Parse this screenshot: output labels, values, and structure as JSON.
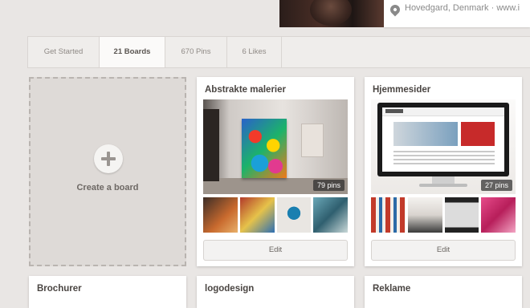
{
  "header": {
    "location": "Hovedgard, Denmark · www.i"
  },
  "tabs": [
    {
      "label": "Get Started"
    },
    {
      "label": "21 Boards"
    },
    {
      "label": "670 Pins"
    },
    {
      "label": "6 Likes"
    }
  ],
  "create_board": {
    "label": "Create a board"
  },
  "boards": [
    {
      "title": "Abstrakte malerier",
      "count": "79 pins",
      "edit": "Edit"
    },
    {
      "title": "Hjemmesider",
      "count": "27 pins",
      "edit": "Edit"
    }
  ],
  "boards_row2": [
    {
      "title": "Brochurer"
    },
    {
      "title": "logodesign"
    },
    {
      "title": "Reklame"
    }
  ],
  "colors": {
    "background": "#e9e6e4",
    "card": "#ffffff",
    "tab_active": "#fbfaf9"
  }
}
